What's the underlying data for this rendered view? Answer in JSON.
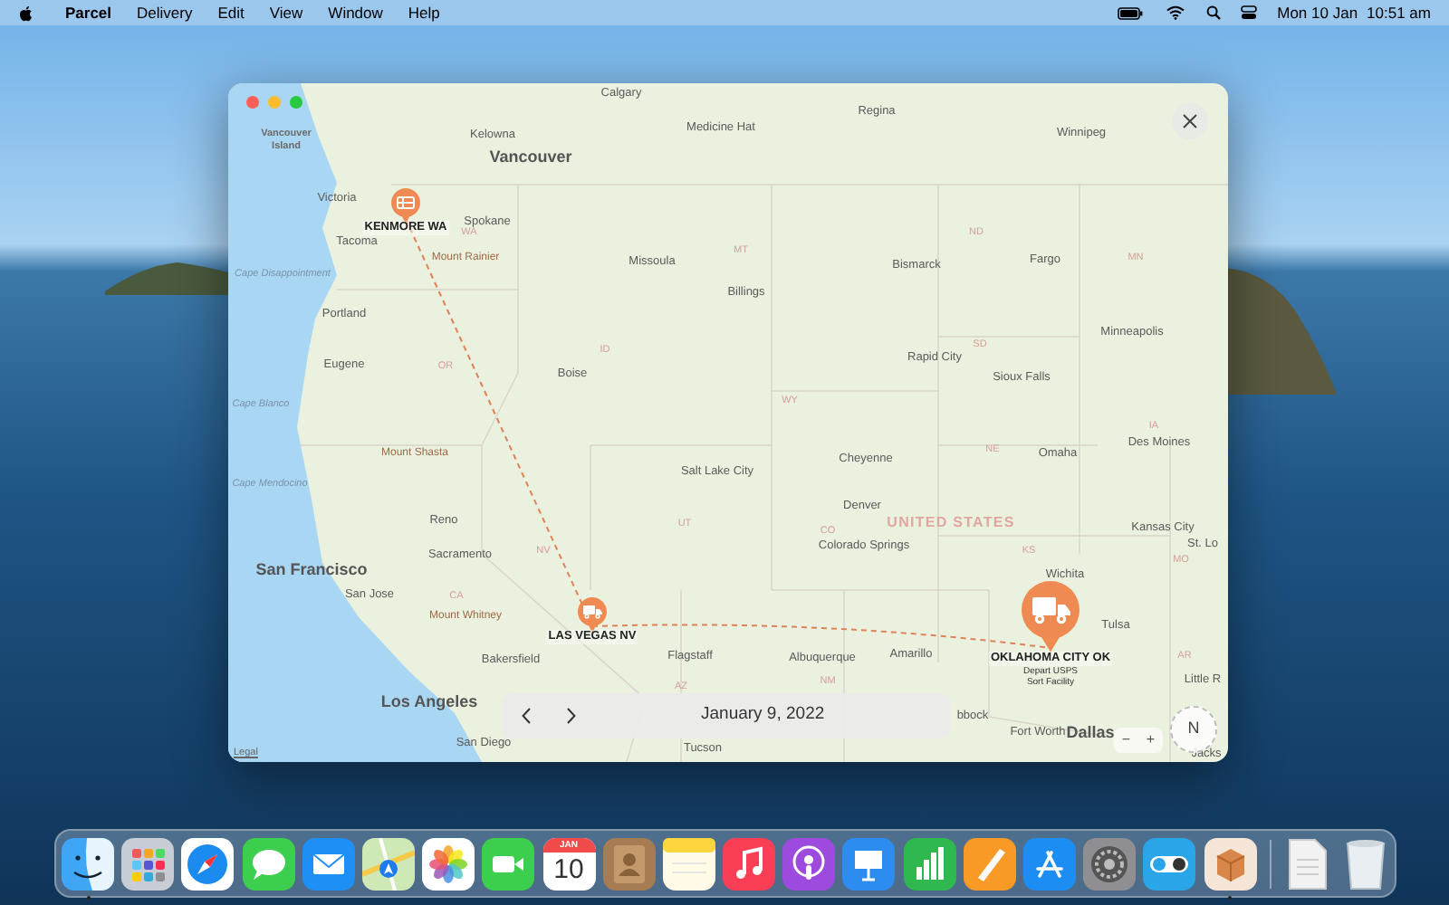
{
  "menu_bar": {
    "app_name": "Parcel",
    "menus": [
      "Delivery",
      "Edit",
      "View",
      "Window",
      "Help"
    ],
    "date": "Mon 10 Jan",
    "time": "10:51 am"
  },
  "window": {
    "map_labels": [
      {
        "text": "Calgary",
        "kind": "city"
      },
      {
        "text": "Vancouver Island",
        "kind": "island"
      },
      {
        "text": "Kelowna",
        "kind": "city"
      },
      {
        "text": "Medicine Hat",
        "kind": "city"
      },
      {
        "text": "Regina",
        "kind": "city"
      },
      {
        "text": "Winnipeg",
        "kind": "city"
      },
      {
        "text": "Vancouver",
        "kind": "major"
      },
      {
        "text": "Victoria",
        "kind": "city"
      },
      {
        "text": "Spokane",
        "kind": "city"
      },
      {
        "text": "WA",
        "kind": "state"
      },
      {
        "text": "Tacoma",
        "kind": "city"
      },
      {
        "text": "Mount Rainier",
        "kind": "feature"
      },
      {
        "text": "Cape Disappointment",
        "kind": "cape"
      },
      {
        "text": "Missoula",
        "kind": "city"
      },
      {
        "text": "MT",
        "kind": "state"
      },
      {
        "text": "ND",
        "kind": "state"
      },
      {
        "text": "MN",
        "kind": "state"
      },
      {
        "text": "Bismarck",
        "kind": "city"
      },
      {
        "text": "Fargo",
        "kind": "city"
      },
      {
        "text": "Portland",
        "kind": "city"
      },
      {
        "text": "Billings",
        "kind": "city"
      },
      {
        "text": "Minneapolis",
        "kind": "city"
      },
      {
        "text": "ID",
        "kind": "state"
      },
      {
        "text": "OR",
        "kind": "state"
      },
      {
        "text": "Eugene",
        "kind": "city"
      },
      {
        "text": "Boise",
        "kind": "city"
      },
      {
        "text": "Rapid City",
        "kind": "city"
      },
      {
        "text": "SD",
        "kind": "state"
      },
      {
        "text": "Sioux Falls",
        "kind": "city"
      },
      {
        "text": "Cape Blanco",
        "kind": "cape"
      },
      {
        "text": "WY",
        "kind": "state"
      },
      {
        "text": "IA",
        "kind": "state"
      },
      {
        "text": "Des Moines",
        "kind": "city"
      },
      {
        "text": "Mount Shasta",
        "kind": "feature"
      },
      {
        "text": "Cape Mendocino",
        "kind": "cape"
      },
      {
        "text": "Salt Lake City",
        "kind": "city"
      },
      {
        "text": "Cheyenne",
        "kind": "city"
      },
      {
        "text": "NE",
        "kind": "state"
      },
      {
        "text": "Omaha",
        "kind": "city"
      },
      {
        "text": "Reno",
        "kind": "city"
      },
      {
        "text": "UT",
        "kind": "state"
      },
      {
        "text": "Denver",
        "kind": "city"
      },
      {
        "text": "UNITED STATES",
        "kind": "country"
      },
      {
        "text": "Kansas City",
        "kind": "city"
      },
      {
        "text": "St. Lo",
        "kind": "city"
      },
      {
        "text": "CO",
        "kind": "state"
      },
      {
        "text": "Colorado Springs",
        "kind": "city"
      },
      {
        "text": "KS",
        "kind": "state"
      },
      {
        "text": "MO",
        "kind": "state"
      },
      {
        "text": "NV",
        "kind": "state"
      },
      {
        "text": "Sacramento",
        "kind": "city"
      },
      {
        "text": "San Francisco",
        "kind": "major"
      },
      {
        "text": "San Jose",
        "kind": "city"
      },
      {
        "text": "CA",
        "kind": "state"
      },
      {
        "text": "Wichita",
        "kind": "city"
      },
      {
        "text": "Mount Whitney",
        "kind": "feature"
      },
      {
        "text": "Tulsa",
        "kind": "city"
      },
      {
        "text": "Bakersfield",
        "kind": "city"
      },
      {
        "text": "Flagstaff",
        "kind": "city"
      },
      {
        "text": "Albuquerque",
        "kind": "city"
      },
      {
        "text": "Amarillo",
        "kind": "city"
      },
      {
        "text": "NM",
        "kind": "state"
      },
      {
        "text": "AR",
        "kind": "state"
      },
      {
        "text": "Little R",
        "kind": "city"
      },
      {
        "text": "AZ",
        "kind": "state"
      },
      {
        "text": "Los Angeles",
        "kind": "major"
      },
      {
        "text": "San Diego",
        "kind": "city"
      },
      {
        "text": "Tucson",
        "kind": "city"
      },
      {
        "text": "bbock",
        "kind": "city"
      },
      {
        "text": "Fort Worth",
        "kind": "city"
      },
      {
        "text": "Dallas",
        "kind": "major"
      },
      {
        "text": "Jacks",
        "kind": "city"
      }
    ],
    "pins": [
      {
        "label": "KENMORE WA",
        "kind": "box",
        "current": false
      },
      {
        "label": "LAS VEGAS NV",
        "kind": "truck",
        "current": false
      },
      {
        "label": "OKLAHOMA CITY OK",
        "details": [
          "Depart USPS",
          "Sort Facility"
        ],
        "kind": "truck",
        "current": true
      }
    ],
    "legal_link": "Legal",
    "date_bar": {
      "date": "January 9, 2022"
    },
    "compass": {
      "label": "N"
    },
    "zoom": {
      "minus": "−",
      "plus": "+"
    }
  },
  "dock": [
    {
      "kind": "finder",
      "running": true
    },
    {
      "kind": "launchpad",
      "running": false
    },
    {
      "kind": "safari",
      "running": false
    },
    {
      "kind": "messages",
      "running": false
    },
    {
      "kind": "mail",
      "running": false
    },
    {
      "kind": "maps",
      "running": false
    },
    {
      "kind": "photos",
      "running": false
    },
    {
      "kind": "facetime",
      "running": false
    },
    {
      "kind": "calendar",
      "month": "JAN",
      "day": "10",
      "running": false
    },
    {
      "kind": "contacts",
      "running": false
    },
    {
      "kind": "notes",
      "running": false
    },
    {
      "kind": "music",
      "running": false
    },
    {
      "kind": "podcasts",
      "running": false
    },
    {
      "kind": "keynote",
      "running": false
    },
    {
      "kind": "numbers",
      "running": false
    },
    {
      "kind": "pages",
      "running": false
    },
    {
      "kind": "appstore",
      "running": false
    },
    {
      "kind": "settings",
      "running": false
    },
    {
      "kind": "toggle",
      "running": false
    },
    {
      "kind": "parcel",
      "running": true
    },
    {
      "kind": "divider"
    },
    {
      "kind": "document",
      "running": false
    },
    {
      "kind": "trash",
      "running": false
    }
  ]
}
